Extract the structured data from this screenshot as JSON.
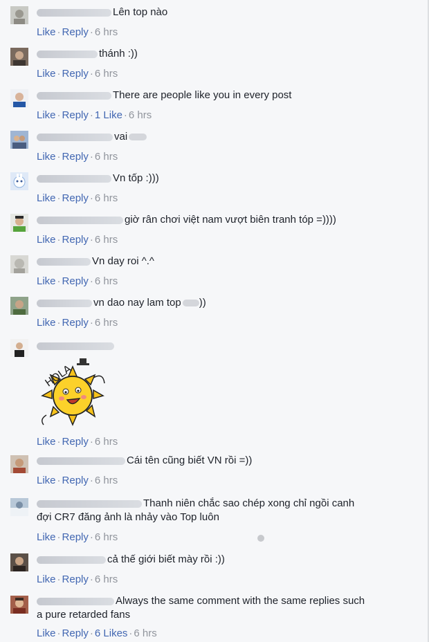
{
  "actions": {
    "like": "Like",
    "reply": "Reply",
    "dot": "·"
  },
  "sticker_text": "HOLA",
  "comments": [
    {
      "text": "Lên top nào",
      "time": "6 hrs"
    },
    {
      "text": "thánh :))",
      "time": "6 hrs"
    },
    {
      "text": "There are people like you in every post",
      "likes": "1 Like",
      "time": "6 hrs"
    },
    {
      "text": "vai",
      "time": "6 hrs"
    },
    {
      "text": "Vn tốp :)))",
      "time": "6 hrs"
    },
    {
      "text": "giờ rân chơi việt nam vượt biên tranh tóp =))))",
      "time": "6 hrs"
    },
    {
      "text": "Vn day roi ^.^",
      "time": "6 hrs"
    },
    {
      "text": "vn dao nay lam top",
      "text_tail": "))",
      "time": "6 hrs"
    },
    {
      "text": "",
      "time": "6 hrs"
    },
    {
      "text": "Cái tên cũng biết VN rồi =))",
      "time": "6 hrs"
    },
    {
      "text": "Thanh niên chắc sao chép xong chỉ ngồi canh",
      "text2": "đợi CR7 đăng ảnh là nhảy vào Top luôn",
      "time": "6 hrs"
    },
    {
      "text": "cả thế giới biết mày rồi :))",
      "time": "6 hrs"
    },
    {
      "text": "Always the same comment with the same replies such",
      "text2": "a pure retarded fans",
      "likes": "6 Likes",
      "time": "6 hrs"
    }
  ]
}
